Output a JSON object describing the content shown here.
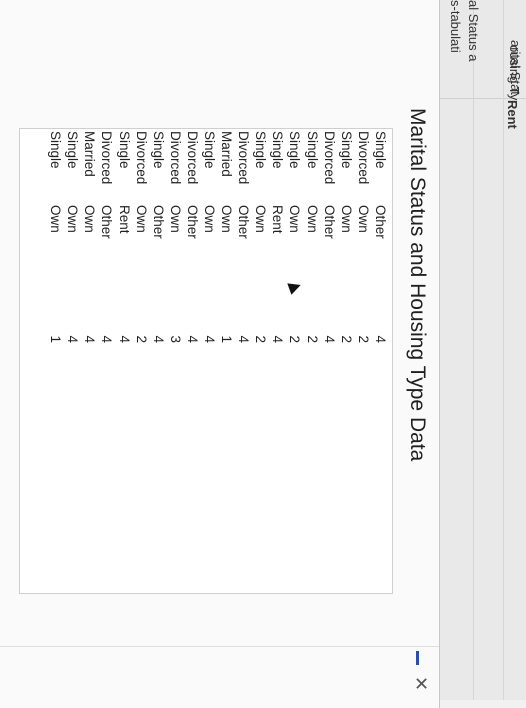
{
  "background_sheet": {
    "cells": [
      "s-tabulati",
      "al Status a",
      "arital Stat",
      "ousing Ty",
      "Rent"
    ]
  },
  "popup": {
    "title": "Marital Status and Housing Type Data",
    "rows": [
      {
        "status": "Single",
        "housing": "Other",
        "value": "4"
      },
      {
        "status": "Divorced",
        "housing": "Own",
        "value": "2"
      },
      {
        "status": "Single",
        "housing": "Own",
        "value": "2"
      },
      {
        "status": "Divorced",
        "housing": "Other",
        "value": "4"
      },
      {
        "status": "Single",
        "housing": "Own",
        "value": "2"
      },
      {
        "status": "Single",
        "housing": "Own",
        "value": "2"
      },
      {
        "status": "Single",
        "housing": "Rent",
        "value": "4"
      },
      {
        "status": "Single",
        "housing": "Own",
        "value": "2"
      },
      {
        "status": "Divorced",
        "housing": "Other",
        "value": "4"
      },
      {
        "status": "Married",
        "housing": "Own",
        "value": "1"
      },
      {
        "status": "Single",
        "housing": "Own",
        "value": "4"
      },
      {
        "status": "Divorced",
        "housing": "Other",
        "value": "4"
      },
      {
        "status": "Divorced",
        "housing": "Own",
        "value": "3"
      },
      {
        "status": "Single",
        "housing": "Other",
        "value": "4"
      },
      {
        "status": "Divorced",
        "housing": "Own",
        "value": "2"
      },
      {
        "status": "Single",
        "housing": "Rent",
        "value": "4"
      },
      {
        "status": "Divorced",
        "housing": "Other",
        "value": "4"
      },
      {
        "status": "Married",
        "housing": "Own",
        "value": "4"
      },
      {
        "status": "Single",
        "housing": "Own",
        "value": "4"
      },
      {
        "status": "Single",
        "housing": "Own",
        "value": "1"
      }
    ]
  },
  "colors": {
    "accent": "#2b4fa8",
    "checkbox_border": "#6a7fb0"
  },
  "icons": {
    "minimize": "minimize-icon",
    "close": "close-icon",
    "cursor": "mouse-pointer-icon"
  }
}
